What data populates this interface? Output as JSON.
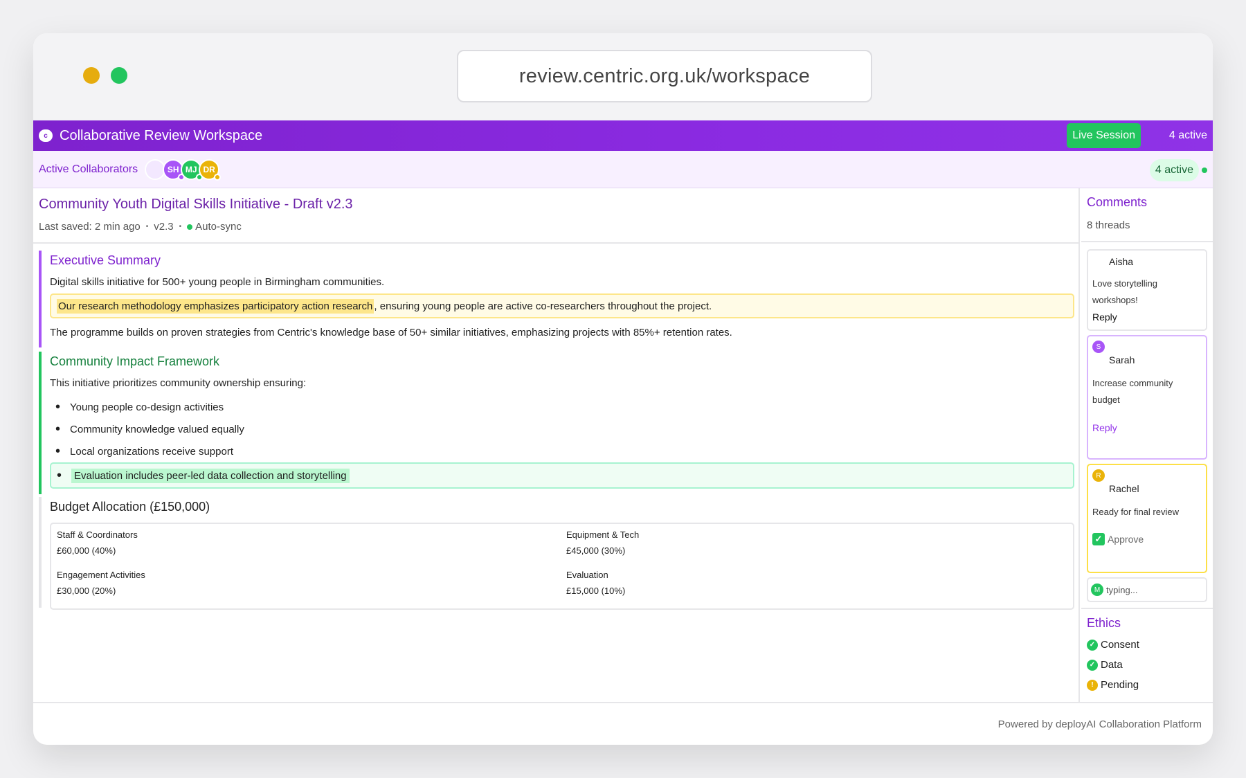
{
  "browser": {
    "url": "review.centric.org.uk/workspace"
  },
  "appbar": {
    "logo_glyph": "c",
    "title": "Collaborative Review Workspace",
    "live_label": "Live Session",
    "active_label": "4 active"
  },
  "collaborators": {
    "label": "Active Collaborators",
    "avatars": [
      {
        "initials": "",
        "color": "#f3e8ff"
      },
      {
        "initials": "SH",
        "color": "#a855f7",
        "status_color": "#a855f7"
      },
      {
        "initials": "MJ",
        "color": "#22c55e",
        "status_color": "#22c55e"
      },
      {
        "initials": "DR",
        "color": "#eab308",
        "status_color": "#eab308"
      }
    ],
    "active_count": "4 active"
  },
  "document": {
    "title": "Community Youth Digital Skills Initiative - Draft v2.3",
    "last_saved": "Last saved: 2 min ago",
    "version": "v2.3",
    "sync_status": "Auto-sync",
    "executive_summary": {
      "heading": "Executive Summary",
      "intro": "Digital skills initiative for 500+ young people in Birmingham communities.",
      "highlight": "Our research methodology emphasizes participatory action research",
      "highlight_rest": ", ensuring young people are active co-researchers throughout the project.",
      "closing": "The programme builds on proven strategies from Centric's knowledge base of 50+ similar initiatives, emphasizing projects with 85%+ retention rates."
    },
    "impact": {
      "heading": "Community Impact Framework",
      "intro": "This initiative prioritizes community ownership ensuring:",
      "bullets": [
        "Young people co-design activities",
        "Community knowledge valued equally",
        "Local organizations receive support"
      ],
      "highlighted_bullet": "Evaluation includes peer-led data collection and storytelling"
    },
    "budget": {
      "heading": "Budget Allocation (£150,000)",
      "items": [
        {
          "label": "Staff & Coordinators",
          "value": "£60,000 (40%)"
        },
        {
          "label": "Equipment & Tech",
          "value": "£45,000 (30%)"
        },
        {
          "label": "Engagement Activities",
          "value": "£30,000 (20%)"
        },
        {
          "label": "Evaluation",
          "value": "£15,000 (10%)"
        }
      ]
    }
  },
  "comments": {
    "title": "Comments",
    "count": "8 threads",
    "threads": [
      {
        "author": "Aisha",
        "text": "Love storytelling workshops!",
        "action": "Reply"
      },
      {
        "author": "Sarah",
        "initial": "S",
        "color": "#a855f7",
        "text": "Increase community budget",
        "action": "Reply"
      },
      {
        "author": "Rachel",
        "initial": "R",
        "color": "#eab308",
        "text": "Ready for final review",
        "action": "Approve"
      }
    ],
    "typing": {
      "initial": "M",
      "color": "#22c55e",
      "text": "typing..."
    }
  },
  "ethics": {
    "title": "Ethics",
    "items": [
      {
        "label": "Consent",
        "icon": "check-icon",
        "color": "#22c55e",
        "glyph": "✓"
      },
      {
        "label": "Data",
        "icon": "check-icon",
        "color": "#22c55e",
        "glyph": "✓"
      },
      {
        "label": "Pending",
        "icon": "alert-icon",
        "color": "#eab308",
        "glyph": "!"
      }
    ]
  },
  "footer": {
    "text": "Powered by deployAI Collaboration Platform"
  }
}
